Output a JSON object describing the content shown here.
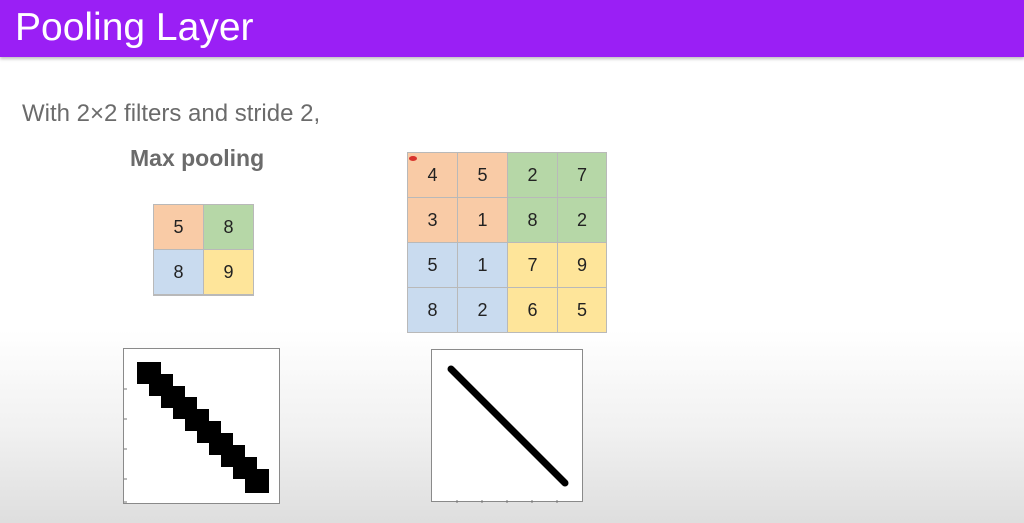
{
  "slide": {
    "title": "Pooling Layer",
    "subtitle": "With 2×2 filters and stride 2,",
    "max_pooling_label": "Max pooling",
    "output_grid": [
      [
        "5",
        "8"
      ],
      [
        "8",
        "9"
      ]
    ],
    "input_grid": [
      [
        "4",
        "5",
        "2",
        "7"
      ],
      [
        "3",
        "1",
        "8",
        "2"
      ],
      [
        "5",
        "1",
        "7",
        "9"
      ],
      [
        "8",
        "2",
        "6",
        "5"
      ]
    ],
    "colors": {
      "title_bar": "#9a1ff5",
      "orange": "#f9cba6",
      "green": "#b6d7a7",
      "blue": "#c9dbef",
      "yellow": "#fee59a",
      "text_gray": "#6b6b6b"
    },
    "left_plot": "pixelated diagonal line (pooled image)",
    "right_plot": "smooth diagonal line (original image)"
  }
}
